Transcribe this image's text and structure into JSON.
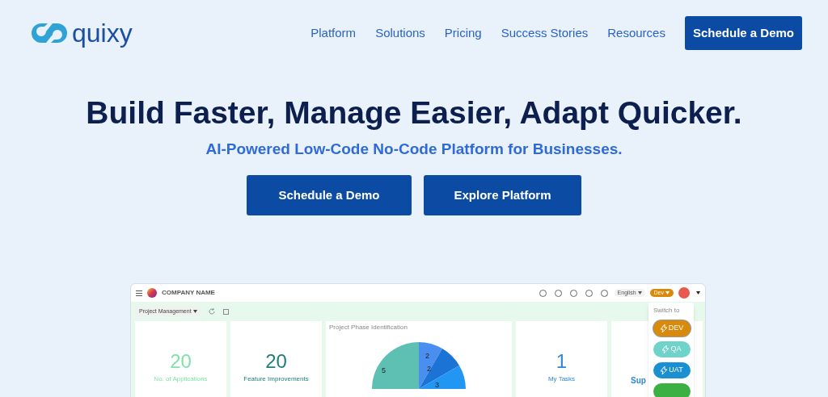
{
  "header": {
    "logo_text": "quixy",
    "nav": [
      "Platform",
      "Solutions",
      "Pricing",
      "Success Stories",
      "Resources"
    ],
    "cta": "Schedule a Demo"
  },
  "hero": {
    "title": "Build Faster, Manage Easier, Adapt Quicker.",
    "subtitle": "AI-Powered Low-Code No-Code Platform for Businesses.",
    "buttons": [
      "Schedule a Demo",
      "Explore Platform"
    ]
  },
  "dashboard": {
    "company": "COMPANY NAME",
    "language": "English",
    "environment": "Dev",
    "module": "Project Management",
    "cards": [
      {
        "kind": "stat",
        "value": "20",
        "label": "No. of Applications",
        "color": "#7fe3a8"
      },
      {
        "kind": "stat",
        "value": "20",
        "label": "Feature Improvements",
        "color": "#1f7f78"
      },
      {
        "kind": "pie",
        "title": "Project Phase Identification",
        "slice_labels": [
          "5",
          "2",
          "2",
          "3"
        ]
      },
      {
        "kind": "stat",
        "value": "1",
        "label": "My Tasks",
        "color": "#2f86d9"
      },
      {
        "kind": "stat",
        "label": "Sup",
        "color": "#2f86d9"
      }
    ],
    "switcher": {
      "title": "Switch to",
      "items": [
        {
          "label": "DEV",
          "color": "#d98a0a",
          "selected": true
        },
        {
          "label": "QA",
          "color": "#6fd3c9",
          "selected": false
        },
        {
          "label": "UAT",
          "color": "#1a8fd1",
          "selected": false
        },
        {
          "color": "#3cb043",
          "selected": false
        }
      ]
    }
  }
}
